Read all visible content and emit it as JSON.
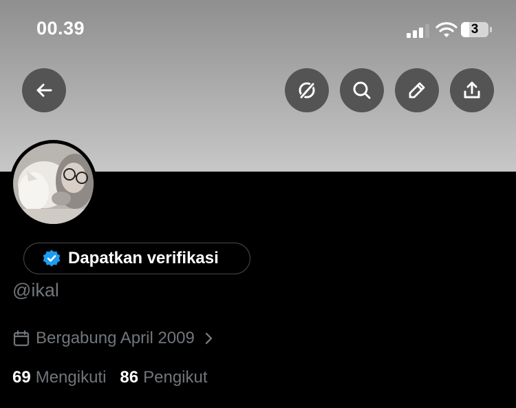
{
  "status_bar": {
    "time": "00.39",
    "battery": "3",
    "battery_level": 0.3
  },
  "header": {
    "actions": [
      {
        "icon": "back-arrow-icon"
      },
      {
        "icon": "grok-icon"
      },
      {
        "icon": "search-icon"
      },
      {
        "icon": "edit-pencil-icon"
      },
      {
        "icon": "share-icon"
      }
    ]
  },
  "profile": {
    "verify_label": "Dapatkan verifikasi",
    "handle": "@ikal",
    "joined": "Bergabung April 2009",
    "following_count": "69",
    "following_label": "Mengikuti",
    "followers_count": "86",
    "followers_label": "Pengikut"
  },
  "colors": {
    "verified_badge": "#1d9bf0",
    "secondary_text": "#71767b",
    "button_bg": "#545454"
  }
}
